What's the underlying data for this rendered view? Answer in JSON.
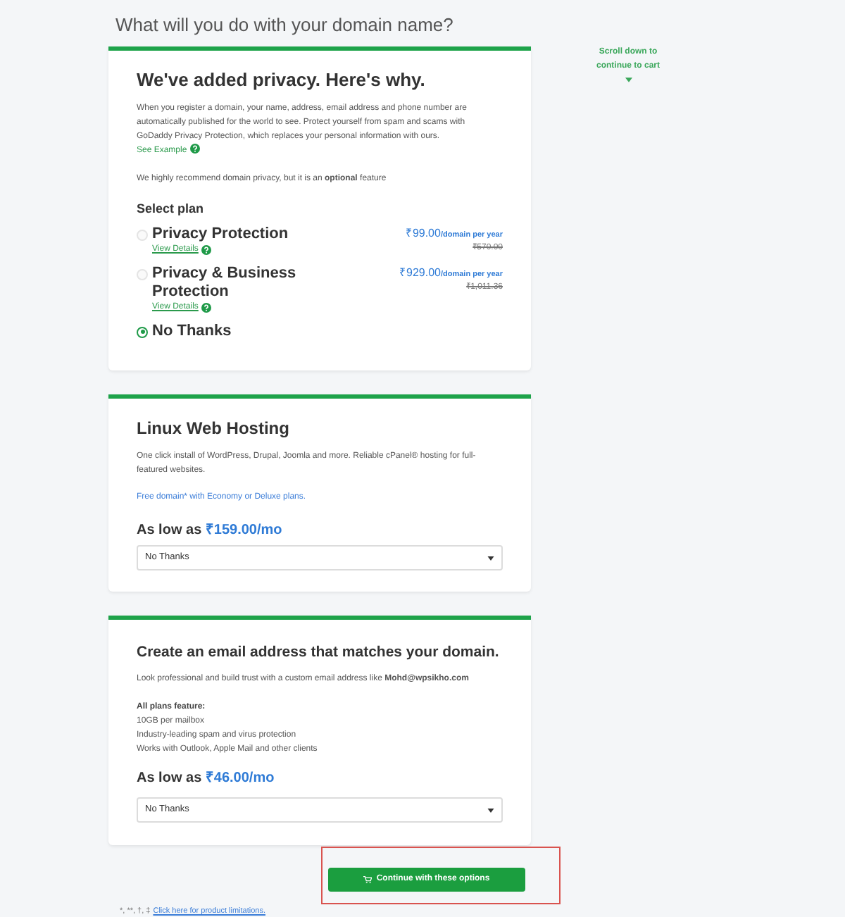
{
  "heading": "What will you do with your domain name?",
  "scroll_hint": "Scroll down to continue to cart",
  "privacy_card": {
    "title": "We've added privacy. Here's why.",
    "description": "When you register a domain, your name, address, email address and phone number are automatically published for the world to see. Protect yourself from spam and scams with GoDaddy Privacy Protection, which replaces your personal information with ours.",
    "description_link": "See Example",
    "recommendation": "We highly recommend domain privacy, but it is an **optional** feature",
    "select_label": "Select plan",
    "plans": [
      {
        "name": "Privacy Protection",
        "selected": false,
        "details_link": "View Details",
        "price": "₹99.00",
        "price_unit": "/domain per year",
        "original_price": "₹570.00"
      },
      {
        "name": "Privacy & Business Protection",
        "selected": false,
        "details_link": "View Details",
        "price": "₹929.00",
        "price_unit": "/domain per year",
        "original_price": "₹1,011.36"
      },
      {
        "name": "No Thanks",
        "selected": true
      }
    ]
  },
  "hosting_card": {
    "title": "Linux Web Hosting",
    "description": "One click install of WordPress, Drupal, Joomla and more. Reliable cPanel® hosting for full-featured websites.",
    "promo_link": "Free domain* with Economy or Deluxe plans.",
    "price_prefix": "As low as",
    "price": "₹159.00/mo",
    "dropdown_value": "No Thanks"
  },
  "email_card": {
    "title": "Create an email address that matches your domain.",
    "description": "Look professional and build trust with a custom email address like **Mohd@wpsikho.com**",
    "features_title": "All plans feature:",
    "features": [
      "10GB per mailbox",
      "Industry-leading spam and virus protection",
      "Works with Outlook, Apple Mail and other clients"
    ],
    "price_prefix": "As low as",
    "price": "₹46.00/mo",
    "dropdown_value": "No Thanks"
  },
  "continue_button": "Continue with these options",
  "footnote": {
    "marks": "*, **, †, ‡",
    "link": "Click here for product limitations."
  }
}
